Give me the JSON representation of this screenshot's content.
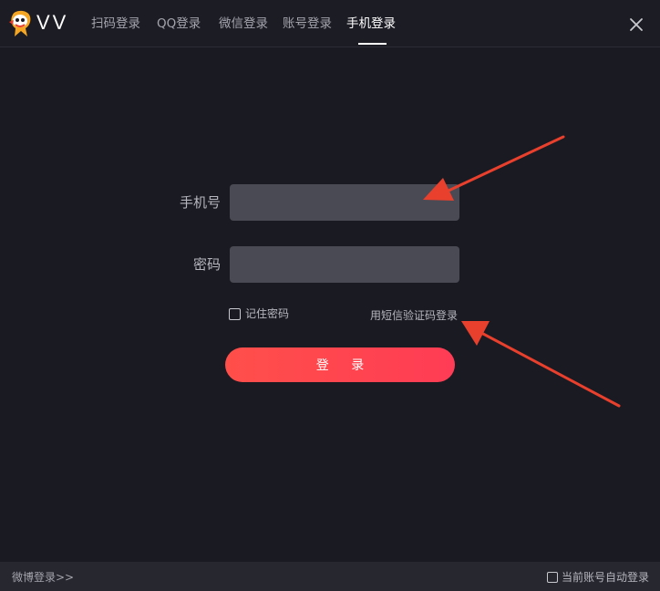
{
  "header": {
    "app_name": "VV",
    "tabs": [
      {
        "label": "扫码登录",
        "active": false
      },
      {
        "label": "QQ登录",
        "active": false
      },
      {
        "label": "微信登录",
        "active": false
      },
      {
        "label": "账号登录",
        "active": false
      },
      {
        "label": "手机登录",
        "active": true
      }
    ],
    "close_icon": "close-icon",
    "logo_icon": "mascot-logo-icon"
  },
  "form": {
    "phone_label": "手机号",
    "phone_value": "",
    "password_label": "密码",
    "password_value": "",
    "remember_label": "记住密码",
    "remember_checked": false,
    "sms_link": "用短信验证码登录",
    "login_button": "登 录"
  },
  "footer": {
    "weibo_link": "微博登录>>",
    "auto_login_label": "当前账号自动登录",
    "auto_login_checked": false
  },
  "colors": {
    "background": "#1a1a23",
    "input_bg": "#4a4a54",
    "accent": "#ff4a4f",
    "arrow": "#e8402c"
  }
}
